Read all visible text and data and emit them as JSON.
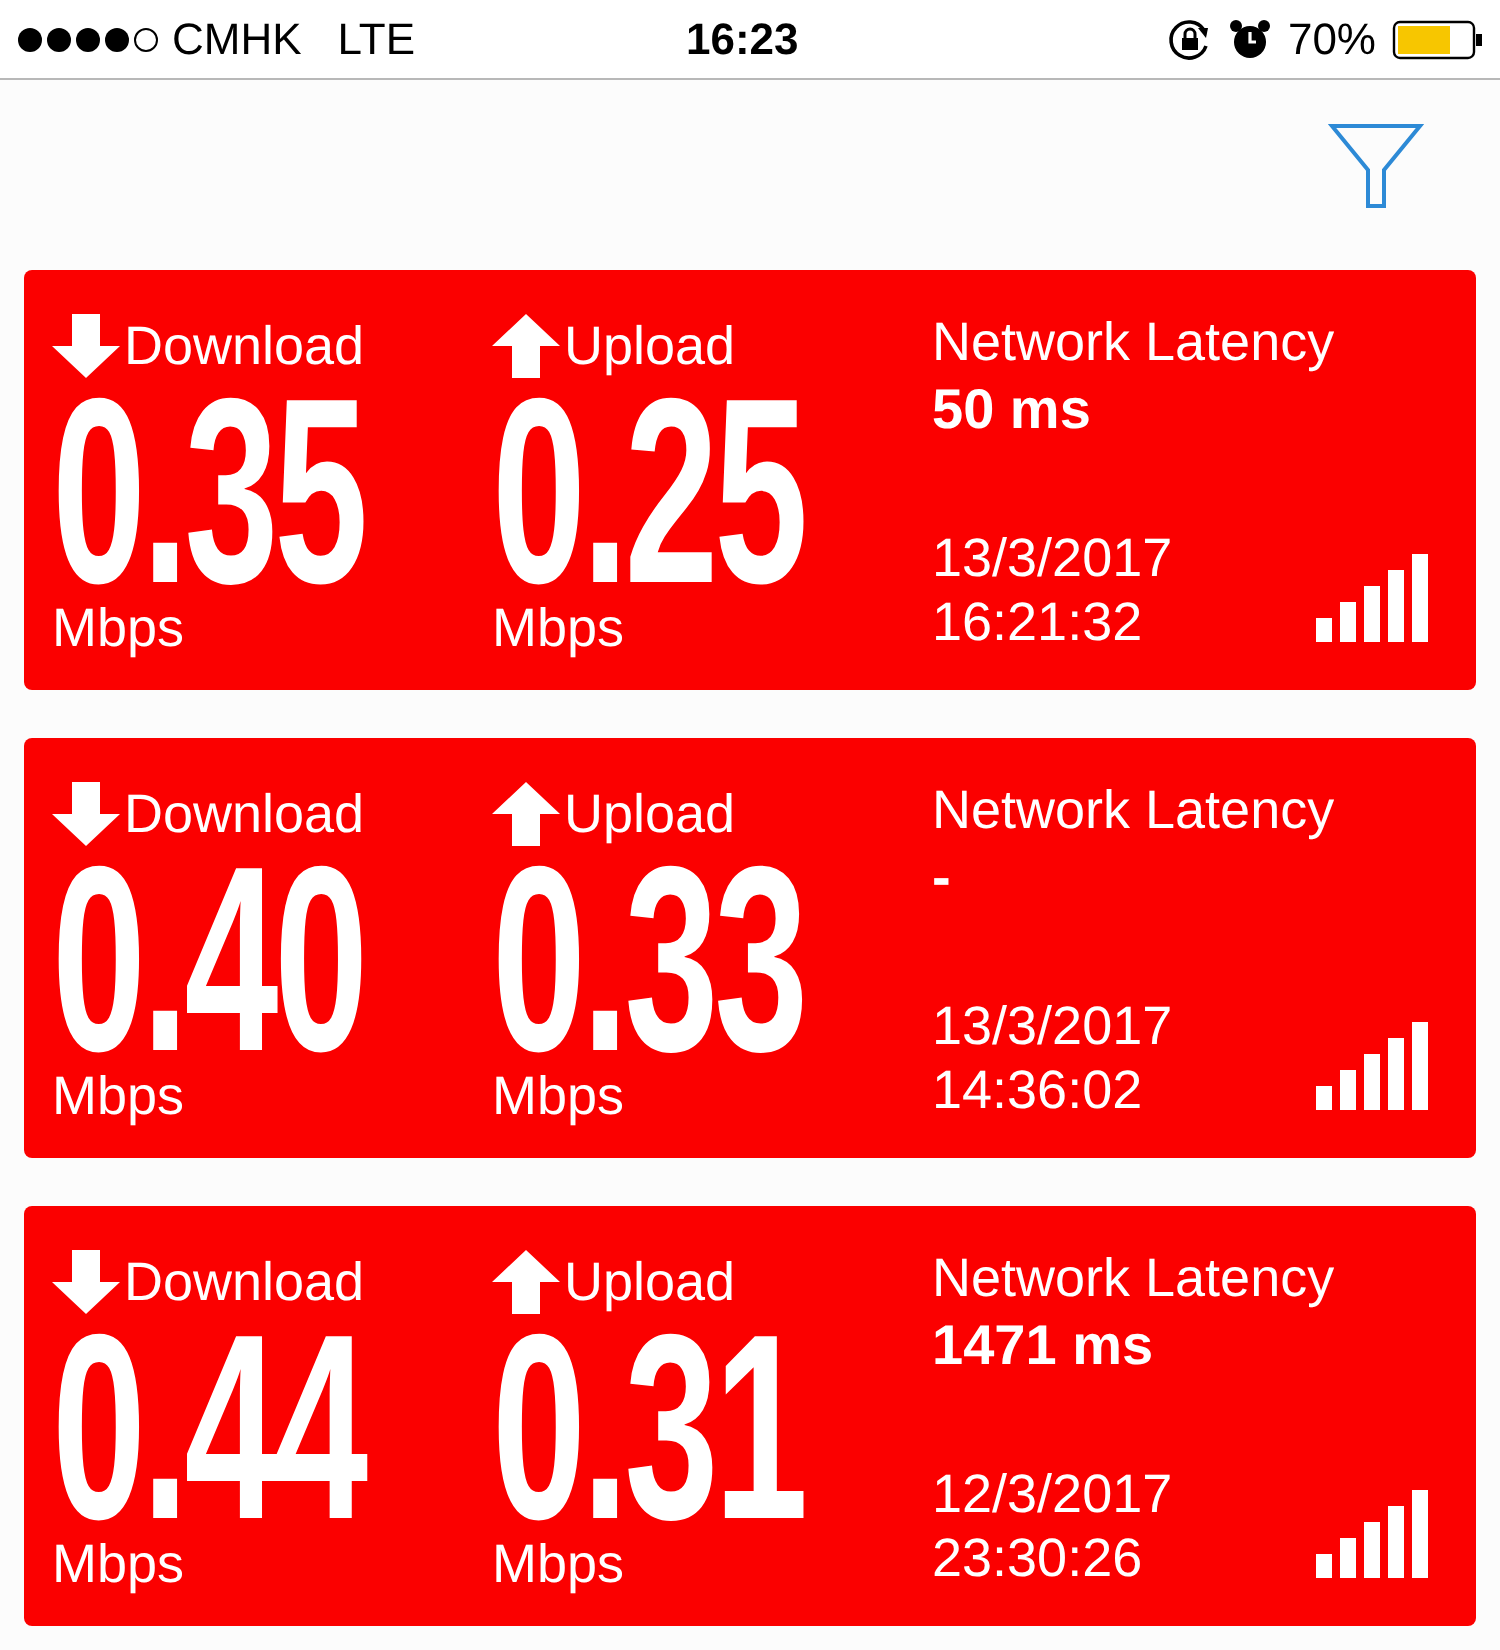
{
  "status_bar": {
    "carrier": "CMHK",
    "network": "LTE",
    "time": "16:23",
    "battery": "70%"
  },
  "results": [
    {
      "download_label": "Download",
      "download": "0.35",
      "download_unit": "Mbps",
      "upload_label": "Upload",
      "upload": "0.25",
      "upload_unit": "Mbps",
      "latency_label": "Network Latency",
      "latency": "50 ms",
      "date": "13/3/2017",
      "time": "16:21:32"
    },
    {
      "download_label": "Download",
      "download": "0.40",
      "download_unit": "Mbps",
      "upload_label": "Upload",
      "upload": "0.33",
      "upload_unit": "Mbps",
      "latency_label": "Network Latency",
      "latency": "-",
      "date": "13/3/2017",
      "time": "14:36:02"
    },
    {
      "download_label": "Download",
      "download": "0.44",
      "download_unit": "Mbps",
      "upload_label": "Upload",
      "upload": "0.31",
      "upload_unit": "Mbps",
      "latency_label": "Network Latency",
      "latency": "1471 ms",
      "date": "12/3/2017",
      "time": "23:30:26"
    }
  ]
}
